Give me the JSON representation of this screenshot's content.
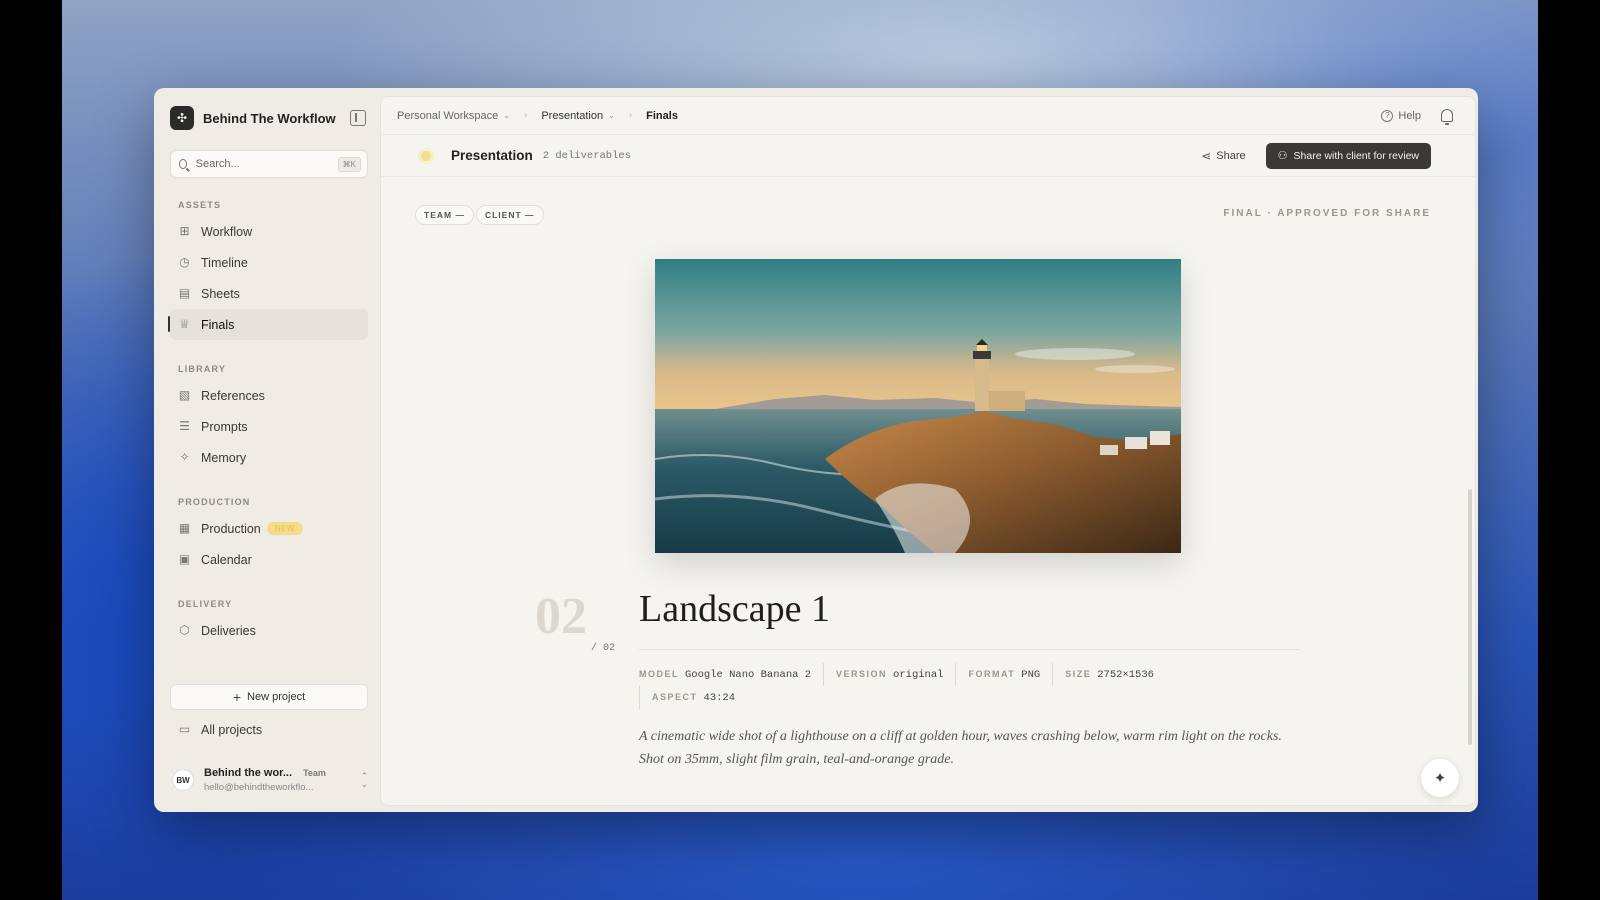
{
  "app": {
    "name": "Behind The Workflow"
  },
  "search": {
    "placeholder": "Search...",
    "shortcut": "⌘K"
  },
  "sidebar": {
    "sections": {
      "assets": "ASSETS",
      "library": "LIBRARY",
      "production": "PRODUCTION",
      "delivery": "DELIVERY"
    },
    "items": {
      "workflow": "Workflow",
      "timeline": "Timeline",
      "sheets": "Sheets",
      "finals": "Finals",
      "references": "References",
      "prompts": "Prompts",
      "memory": "Memory",
      "production": "Production",
      "production_badge": "NEW",
      "calendar": "Calendar",
      "deliveries": "Deliveries"
    },
    "new_project": "New project",
    "all_projects": "All projects",
    "user": {
      "initials": "BW",
      "name": "Behind the wor...",
      "team": "Team",
      "email": "hello@behindtheworkflo..."
    }
  },
  "breadcrumb": [
    "Personal Workspace",
    "Presentation",
    "Finals"
  ],
  "topbar": {
    "help": "Help"
  },
  "subbar": {
    "title": "Presentation",
    "deliverables": "2 deliverables",
    "share": "Share",
    "share_client": "Share with client for review"
  },
  "chips": [
    "TEAM —",
    "CLIENT —"
  ],
  "final_label": "FINAL · APPROVED FOR SHARE",
  "deliverable": {
    "index": "02",
    "total": "/ 02",
    "title": "Landscape 1",
    "meta": [
      {
        "key": "MODEL",
        "value": "Google Nano Banana 2"
      },
      {
        "key": "VERSION",
        "value": "original"
      },
      {
        "key": "FORMAT",
        "value": "PNG"
      },
      {
        "key": "SIZE",
        "value": "2752×1536"
      },
      {
        "key": "ASPECT",
        "value": "43:24"
      }
    ],
    "caption": "A cinematic wide shot of a lighthouse on a cliff at golden hour, waves crashing below, warm rim light on the rocks. Shot on 35mm, slight film grain, teal-and-orange grade."
  },
  "icons": {
    "brand": "logo-icon",
    "workflow": "grid-icon",
    "timeline": "clock-icon",
    "sheets": "table-icon",
    "finals": "crown-icon",
    "references": "image-icon",
    "prompts": "chat-icon",
    "memory": "sparkle-icon",
    "production": "clapper-icon",
    "calendar": "calendar-icon",
    "deliveries": "package-icon",
    "all_projects": "folder-icon"
  },
  "colors": {
    "accent_dark": "#3a3936",
    "badge": "#f3dd8a",
    "background": "#efece5"
  }
}
